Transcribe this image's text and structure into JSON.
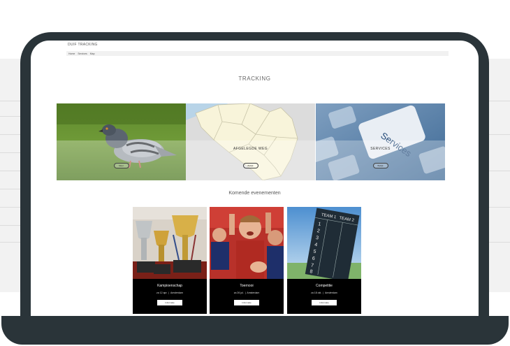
{
  "site": {
    "title": "DUIF TRACKING"
  },
  "nav": [
    "Home",
    "Services",
    "Map"
  ],
  "page_heading": "TRACKING",
  "tiles": [
    {
      "caption": "",
      "button": "Meer"
    },
    {
      "caption": "AFGELEGDE WEG",
      "button": "Bekijk"
    },
    {
      "caption": "SERVICES",
      "button": "Bekijk"
    }
  ],
  "services_key_text": "Services",
  "section_title": "Komende evenementen",
  "events": [
    {
      "title": "Kampioenschap",
      "date": "za 12 apr.",
      "location": "Amsterdam",
      "button": "Informatie"
    },
    {
      "title": "Toernooi",
      "date": "za 26 jul.",
      "location": "Amsterdam",
      "button": "Informatie"
    },
    {
      "title": "Competitie",
      "date": "za 18 okt.",
      "location": "Amsterdam",
      "button": "Informatie"
    }
  ],
  "scoreboard": {
    "team1": "TEAM 1",
    "team2": "TEAM 2",
    "rows": [
      "1",
      "2",
      "3",
      "4",
      "5",
      "6",
      "7",
      "8"
    ]
  }
}
